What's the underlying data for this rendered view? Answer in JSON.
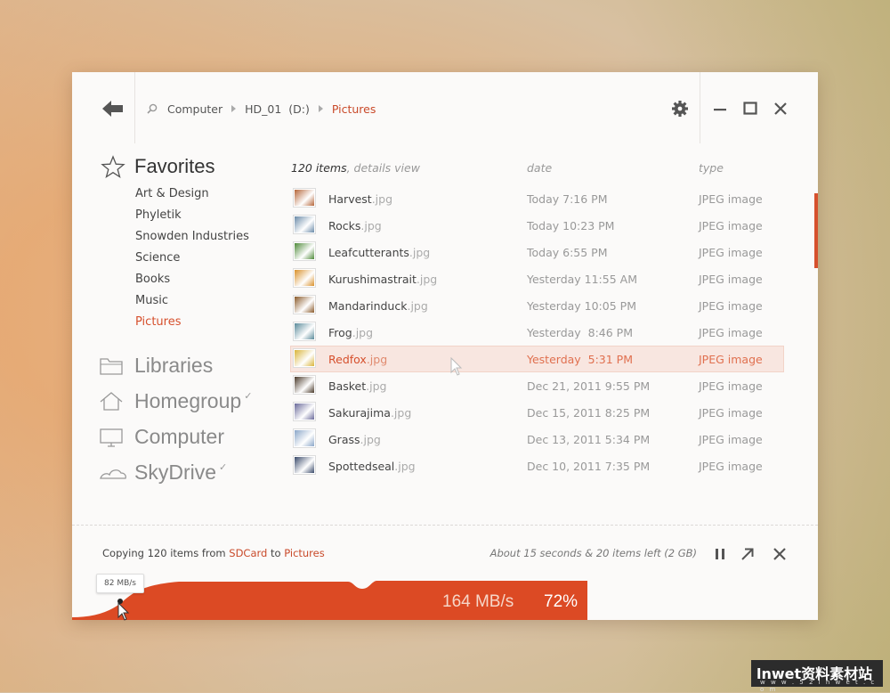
{
  "breadcrumb": [
    "Computer",
    "HD_01  (D:)",
    "Pictures"
  ],
  "favorites": {
    "title": "Favorites",
    "items": [
      "Art & Design",
      "Phyletik",
      "Snowden Industries",
      "Science",
      "Books",
      "Music",
      "Pictures"
    ],
    "selected": "Pictures"
  },
  "nav": [
    {
      "label": "Libraries",
      "icon": "folder-icon",
      "check": ""
    },
    {
      "label": "Homegroup",
      "icon": "home-icon",
      "check": "✓"
    },
    {
      "label": "Computer",
      "icon": "monitor-icon",
      "check": ""
    },
    {
      "label": "SkyDrive",
      "icon": "cloud-icon",
      "check": "✓"
    }
  ],
  "list": {
    "count": "120 items",
    "view": ", details view",
    "col_date": "date",
    "col_type": "type",
    "files": [
      {
        "name": "Harvest",
        "ext": ".jpg",
        "date": "Today 7:16 PM",
        "type": "JPEG image",
        "color": "#b5663a"
      },
      {
        "name": "Rocks",
        "ext": ".jpg",
        "date": "Today 10:23 PM",
        "type": "JPEG image",
        "color": "#6a8aa8"
      },
      {
        "name": "Leafcutterants",
        "ext": ".jpg",
        "date": "Today 6:55 PM",
        "type": "JPEG image",
        "color": "#4f8a3a"
      },
      {
        "name": "Kurushimastrait",
        "ext": ".jpg",
        "date": "Yesterday 11:55 AM",
        "type": "JPEG image",
        "color": "#d9902a"
      },
      {
        "name": "Mandarinduck",
        "ext": ".jpg",
        "date": "Yesterday 10:05 PM",
        "type": "JPEG image",
        "color": "#8a5a2a"
      },
      {
        "name": "Frog",
        "ext": ".jpg",
        "date": "Yesterday  8:46 PM",
        "type": "JPEG image",
        "color": "#5a8a9a"
      },
      {
        "name": "Redfox",
        "ext": ".jpg",
        "date": "Yesterday  5:31 PM",
        "type": "JPEG image",
        "color": "#d9b43a",
        "selected": true
      },
      {
        "name": "Basket",
        "ext": ".jpg",
        "date": "Dec 21, 2011 9:55 PM",
        "type": "JPEG image",
        "color": "#4a3a2a"
      },
      {
        "name": "Sakurajima",
        "ext": ".jpg",
        "date": "Dec 15, 2011 8:25 PM",
        "type": "JPEG image",
        "color": "#6a6a9a"
      },
      {
        "name": "Grass",
        "ext": ".jpg",
        "date": "Dec 13, 2011 5:34 PM",
        "type": "JPEG image",
        "color": "#8aa6c8"
      },
      {
        "name": "Spottedseal",
        "ext": ".jpg",
        "date": "Dec 10, 2011 7:35 PM",
        "type": "JPEG image",
        "color": "#3a4a6a"
      }
    ]
  },
  "copy": {
    "prefix": "Copying 120 items from ",
    "source": "SDCard",
    "mid": " to ",
    "dest": "Pictures",
    "time_left": "About 15 seconds & 20 items left (2 GB)",
    "speed": "164 MB/s",
    "percent": "72%",
    "progress": 0.72,
    "tooltip": "82 MB/s"
  },
  "colors": {
    "accent": "#d6502d",
    "graph": "#dc4a24"
  },
  "watermark": {
    "line1": "lnwet资料素材站",
    "line2": "w w w . 5 2 l n w e t . c o m"
  }
}
